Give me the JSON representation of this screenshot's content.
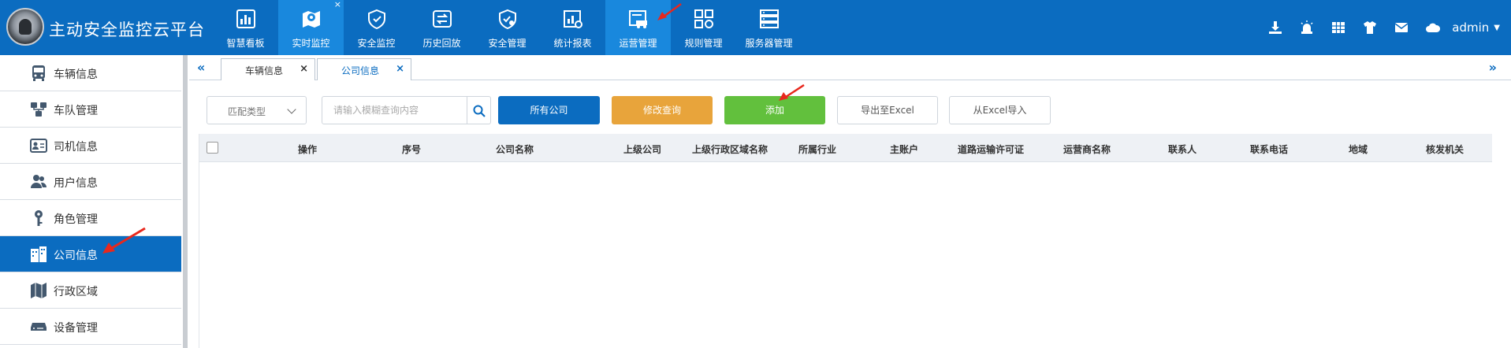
{
  "app": {
    "title": "主动安全监控云平台"
  },
  "nav": [
    {
      "label": "智慧看板",
      "icon": "dashboard-icon"
    },
    {
      "label": "实时监控",
      "icon": "map-pin-icon",
      "close": "×"
    },
    {
      "label": "安全监控",
      "icon": "shield-icon"
    },
    {
      "label": "历史回放",
      "icon": "playback-icon"
    },
    {
      "label": "安全管理",
      "icon": "shield-settings-icon"
    },
    {
      "label": "统计报表",
      "icon": "report-chart-icon"
    },
    {
      "label": "运营管理",
      "icon": "vehicle-management-icon"
    },
    {
      "label": "规则管理",
      "icon": "rules-grid-icon"
    },
    {
      "label": "服务器管理",
      "icon": "server-icon"
    }
  ],
  "toolbar_icons": [
    "download-icon",
    "alarm-siren-icon",
    "grid-list-icon",
    "shirt-icon",
    "mail-icon",
    "cloud-icon"
  ],
  "user": {
    "name": "admin"
  },
  "sidebar": [
    {
      "label": "车辆信息",
      "icon": "bus-icon"
    },
    {
      "label": "车队管理",
      "icon": "fleet-icon"
    },
    {
      "label": "司机信息",
      "icon": "id-card-icon"
    },
    {
      "label": "用户信息",
      "icon": "users-icon"
    },
    {
      "label": "角色管理",
      "icon": "key-icon"
    },
    {
      "label": "公司信息",
      "icon": "company-building-icon"
    },
    {
      "label": "行政区域",
      "icon": "map-icon"
    },
    {
      "label": "设备管理",
      "icon": "device-icon"
    }
  ],
  "tabs": [
    {
      "label": "车辆信息",
      "close": "×"
    },
    {
      "label": "公司信息",
      "close": "×"
    }
  ],
  "tab_nav": {
    "left": "«",
    "right": "»"
  },
  "filter": {
    "match_type": "匹配类型",
    "search_placeholder": "请输入模糊查询内容"
  },
  "buttons": {
    "all_companies": "所有公司",
    "modify_query": "修改查询",
    "add": "添加",
    "export_excel": "导出至Excel",
    "import_excel": "从Excel导入"
  },
  "table": {
    "columns": [
      "操作",
      "序号",
      "公司名称",
      "上级公司",
      "上级行政区域名称",
      "所属行业",
      "主账户",
      "道路运输许可证",
      "运营商名称",
      "联系人",
      "联系电话",
      "地域",
      "核发机关"
    ],
    "rows": []
  },
  "colors": {
    "primary": "#0b6cc0",
    "nav_active": "#1988dd",
    "orange": "#e8a43b",
    "green": "#62c03d",
    "annotation": "#e8281d"
  }
}
